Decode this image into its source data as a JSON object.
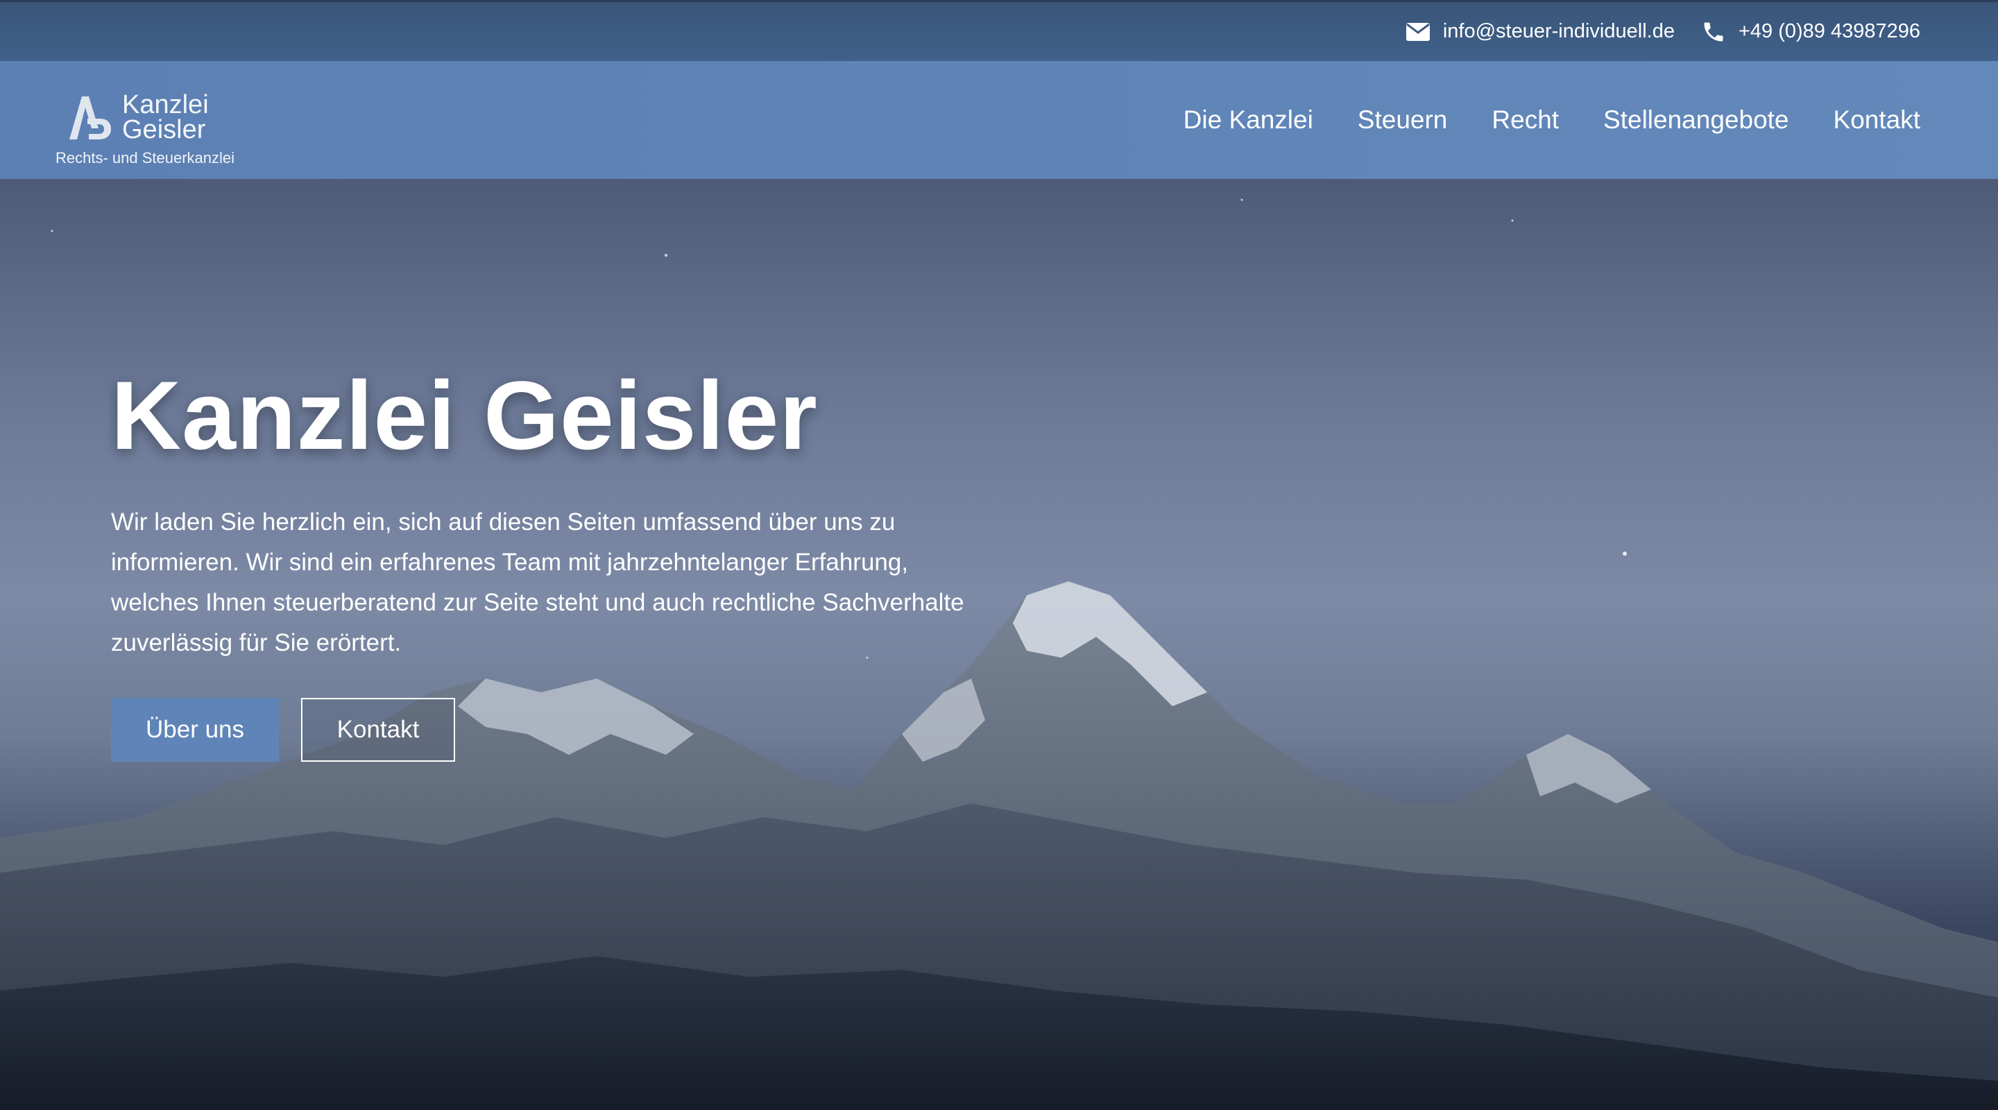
{
  "topbar": {
    "email": "info@steuer-individuell.de",
    "phone": "+49 (0)89 43987296",
    "email_icon": "envelope-icon",
    "phone_icon": "phone-icon"
  },
  "logo": {
    "line1": "Kanzlei",
    "line2": "Geisler",
    "tagline": "Rechts- und Steuerkanzlei"
  },
  "nav": {
    "items": [
      {
        "label": "Die Kanzlei"
      },
      {
        "label": "Steuern"
      },
      {
        "label": "Recht"
      },
      {
        "label": "Stellenangebote"
      },
      {
        "label": "Kontakt"
      }
    ]
  },
  "hero": {
    "title": "Kanzlei Geisler",
    "text": "Wir laden Sie herzlich ein, sich auf diesen Seiten umfassend über uns zu informieren. Wir sind ein erfahrenes Team mit jahrzehntelanger Erfahrung, welches Ihnen steuerberatend zur Seite steht und auch rechtliche Sachverhalte zuverlässig für Sie erörtert.",
    "primary_button": "Über uns",
    "secondary_button": "Kontakt"
  },
  "colors": {
    "topbar": "#3d5a80",
    "navbar": "#6086b8",
    "primary_button": "#5f85b8"
  }
}
